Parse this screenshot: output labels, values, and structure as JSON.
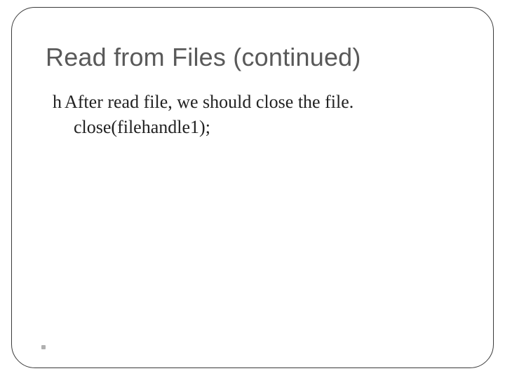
{
  "slide": {
    "title": "Read from Files (continued)",
    "bullet_glyph": "h",
    "bullet_text": "After read file, we should close the file.",
    "code_line": "close(filehandle1);"
  }
}
